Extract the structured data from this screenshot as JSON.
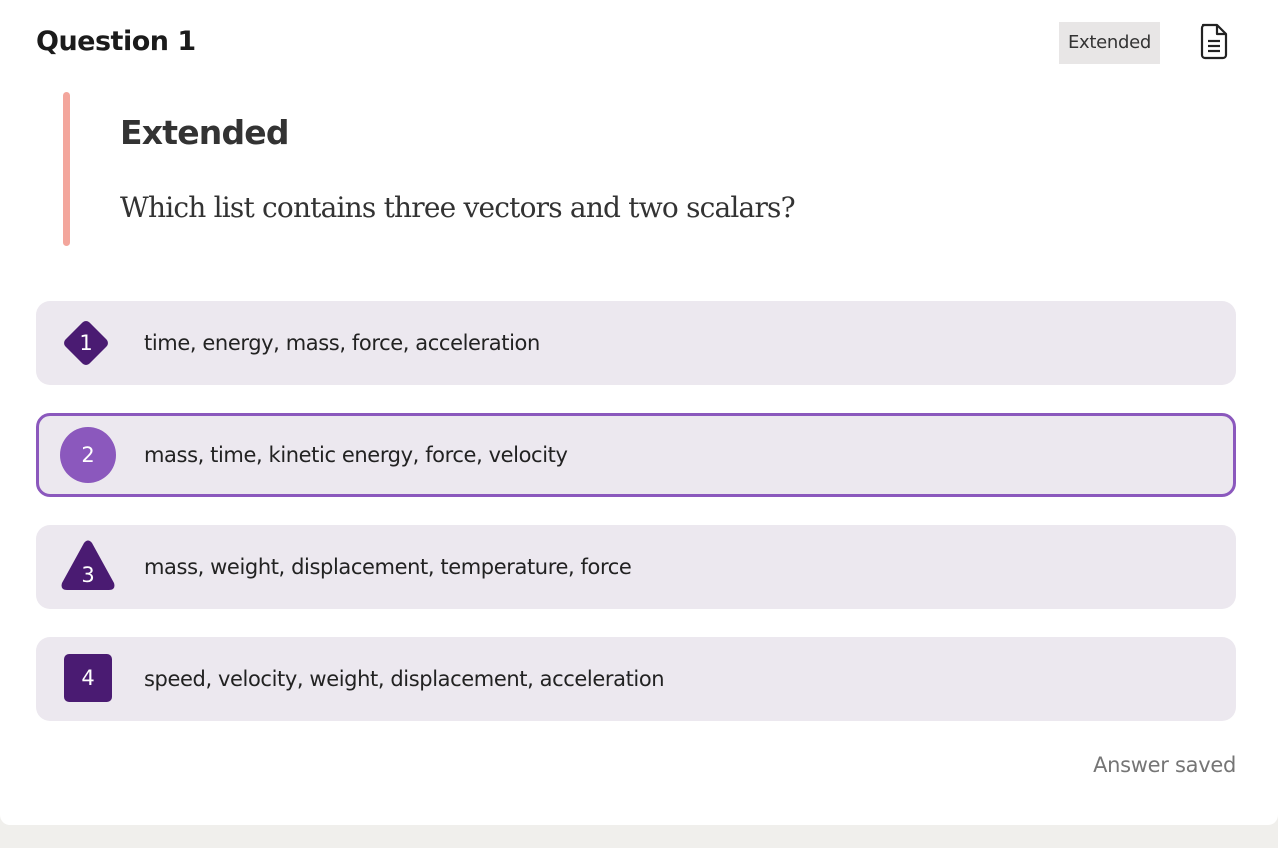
{
  "question": {
    "title": "Question 1",
    "level_badge": "Extended",
    "document_icon": "document-lines-icon",
    "stem_heading": "Extended",
    "stem_text": "Which list contains three vectors and two scalars?"
  },
  "choices": [
    {
      "number": "1",
      "shape": "diamond",
      "text": "time, energy, mass, force, acceleration",
      "selected": false
    },
    {
      "number": "2",
      "shape": "circle",
      "text": "mass, time, kinetic energy, force, velocity",
      "selected": true
    },
    {
      "number": "3",
      "shape": "triangle",
      "text": "mass, weight, displacement, temperature, force",
      "selected": false
    },
    {
      "number": "4",
      "shape": "square",
      "text": "speed, velocity, weight, displacement, acceleration",
      "selected": false
    }
  ],
  "status": {
    "saved_text": "Answer saved"
  },
  "colors": {
    "accent_dark": "#4a1b72",
    "accent_selected": "#8b58bd",
    "stem_bar": "#f3a69c",
    "choice_bg": "#ece8ef"
  }
}
